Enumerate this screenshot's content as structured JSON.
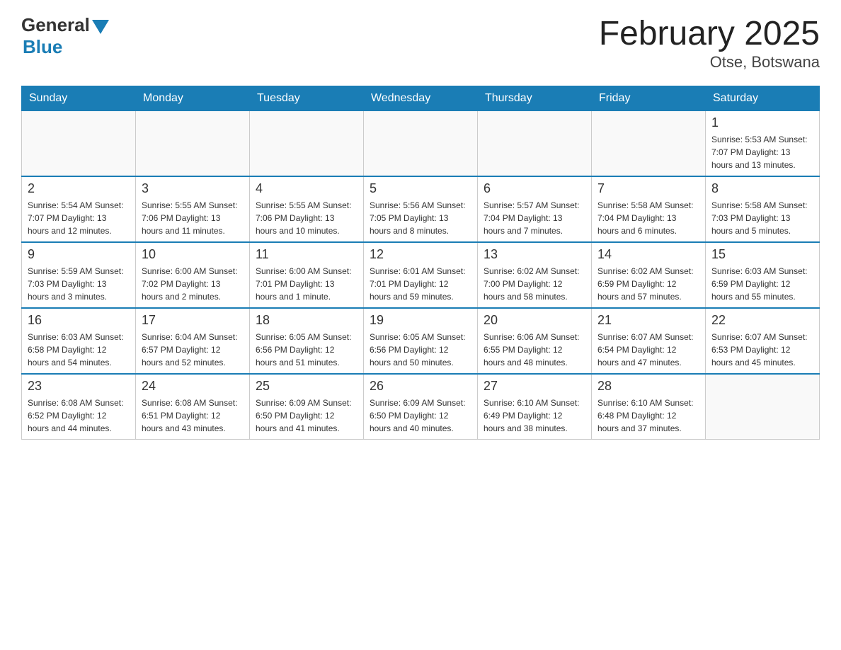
{
  "header": {
    "logo_general": "General",
    "logo_blue": "Blue",
    "title": "February 2025",
    "subtitle": "Otse, Botswana"
  },
  "days_of_week": [
    "Sunday",
    "Monday",
    "Tuesday",
    "Wednesday",
    "Thursday",
    "Friday",
    "Saturday"
  ],
  "weeks": [
    [
      {
        "day": "",
        "info": ""
      },
      {
        "day": "",
        "info": ""
      },
      {
        "day": "",
        "info": ""
      },
      {
        "day": "",
        "info": ""
      },
      {
        "day": "",
        "info": ""
      },
      {
        "day": "",
        "info": ""
      },
      {
        "day": "1",
        "info": "Sunrise: 5:53 AM\nSunset: 7:07 PM\nDaylight: 13 hours and 13 minutes."
      }
    ],
    [
      {
        "day": "2",
        "info": "Sunrise: 5:54 AM\nSunset: 7:07 PM\nDaylight: 13 hours and 12 minutes."
      },
      {
        "day": "3",
        "info": "Sunrise: 5:55 AM\nSunset: 7:06 PM\nDaylight: 13 hours and 11 minutes."
      },
      {
        "day": "4",
        "info": "Sunrise: 5:55 AM\nSunset: 7:06 PM\nDaylight: 13 hours and 10 minutes."
      },
      {
        "day": "5",
        "info": "Sunrise: 5:56 AM\nSunset: 7:05 PM\nDaylight: 13 hours and 8 minutes."
      },
      {
        "day": "6",
        "info": "Sunrise: 5:57 AM\nSunset: 7:04 PM\nDaylight: 13 hours and 7 minutes."
      },
      {
        "day": "7",
        "info": "Sunrise: 5:58 AM\nSunset: 7:04 PM\nDaylight: 13 hours and 6 minutes."
      },
      {
        "day": "8",
        "info": "Sunrise: 5:58 AM\nSunset: 7:03 PM\nDaylight: 13 hours and 5 minutes."
      }
    ],
    [
      {
        "day": "9",
        "info": "Sunrise: 5:59 AM\nSunset: 7:03 PM\nDaylight: 13 hours and 3 minutes."
      },
      {
        "day": "10",
        "info": "Sunrise: 6:00 AM\nSunset: 7:02 PM\nDaylight: 13 hours and 2 minutes."
      },
      {
        "day": "11",
        "info": "Sunrise: 6:00 AM\nSunset: 7:01 PM\nDaylight: 13 hours and 1 minute."
      },
      {
        "day": "12",
        "info": "Sunrise: 6:01 AM\nSunset: 7:01 PM\nDaylight: 12 hours and 59 minutes."
      },
      {
        "day": "13",
        "info": "Sunrise: 6:02 AM\nSunset: 7:00 PM\nDaylight: 12 hours and 58 minutes."
      },
      {
        "day": "14",
        "info": "Sunrise: 6:02 AM\nSunset: 6:59 PM\nDaylight: 12 hours and 57 minutes."
      },
      {
        "day": "15",
        "info": "Sunrise: 6:03 AM\nSunset: 6:59 PM\nDaylight: 12 hours and 55 minutes."
      }
    ],
    [
      {
        "day": "16",
        "info": "Sunrise: 6:03 AM\nSunset: 6:58 PM\nDaylight: 12 hours and 54 minutes."
      },
      {
        "day": "17",
        "info": "Sunrise: 6:04 AM\nSunset: 6:57 PM\nDaylight: 12 hours and 52 minutes."
      },
      {
        "day": "18",
        "info": "Sunrise: 6:05 AM\nSunset: 6:56 PM\nDaylight: 12 hours and 51 minutes."
      },
      {
        "day": "19",
        "info": "Sunrise: 6:05 AM\nSunset: 6:56 PM\nDaylight: 12 hours and 50 minutes."
      },
      {
        "day": "20",
        "info": "Sunrise: 6:06 AM\nSunset: 6:55 PM\nDaylight: 12 hours and 48 minutes."
      },
      {
        "day": "21",
        "info": "Sunrise: 6:07 AM\nSunset: 6:54 PM\nDaylight: 12 hours and 47 minutes."
      },
      {
        "day": "22",
        "info": "Sunrise: 6:07 AM\nSunset: 6:53 PM\nDaylight: 12 hours and 45 minutes."
      }
    ],
    [
      {
        "day": "23",
        "info": "Sunrise: 6:08 AM\nSunset: 6:52 PM\nDaylight: 12 hours and 44 minutes."
      },
      {
        "day": "24",
        "info": "Sunrise: 6:08 AM\nSunset: 6:51 PM\nDaylight: 12 hours and 43 minutes."
      },
      {
        "day": "25",
        "info": "Sunrise: 6:09 AM\nSunset: 6:50 PM\nDaylight: 12 hours and 41 minutes."
      },
      {
        "day": "26",
        "info": "Sunrise: 6:09 AM\nSunset: 6:50 PM\nDaylight: 12 hours and 40 minutes."
      },
      {
        "day": "27",
        "info": "Sunrise: 6:10 AM\nSunset: 6:49 PM\nDaylight: 12 hours and 38 minutes."
      },
      {
        "day": "28",
        "info": "Sunrise: 6:10 AM\nSunset: 6:48 PM\nDaylight: 12 hours and 37 minutes."
      },
      {
        "day": "",
        "info": ""
      }
    ]
  ]
}
